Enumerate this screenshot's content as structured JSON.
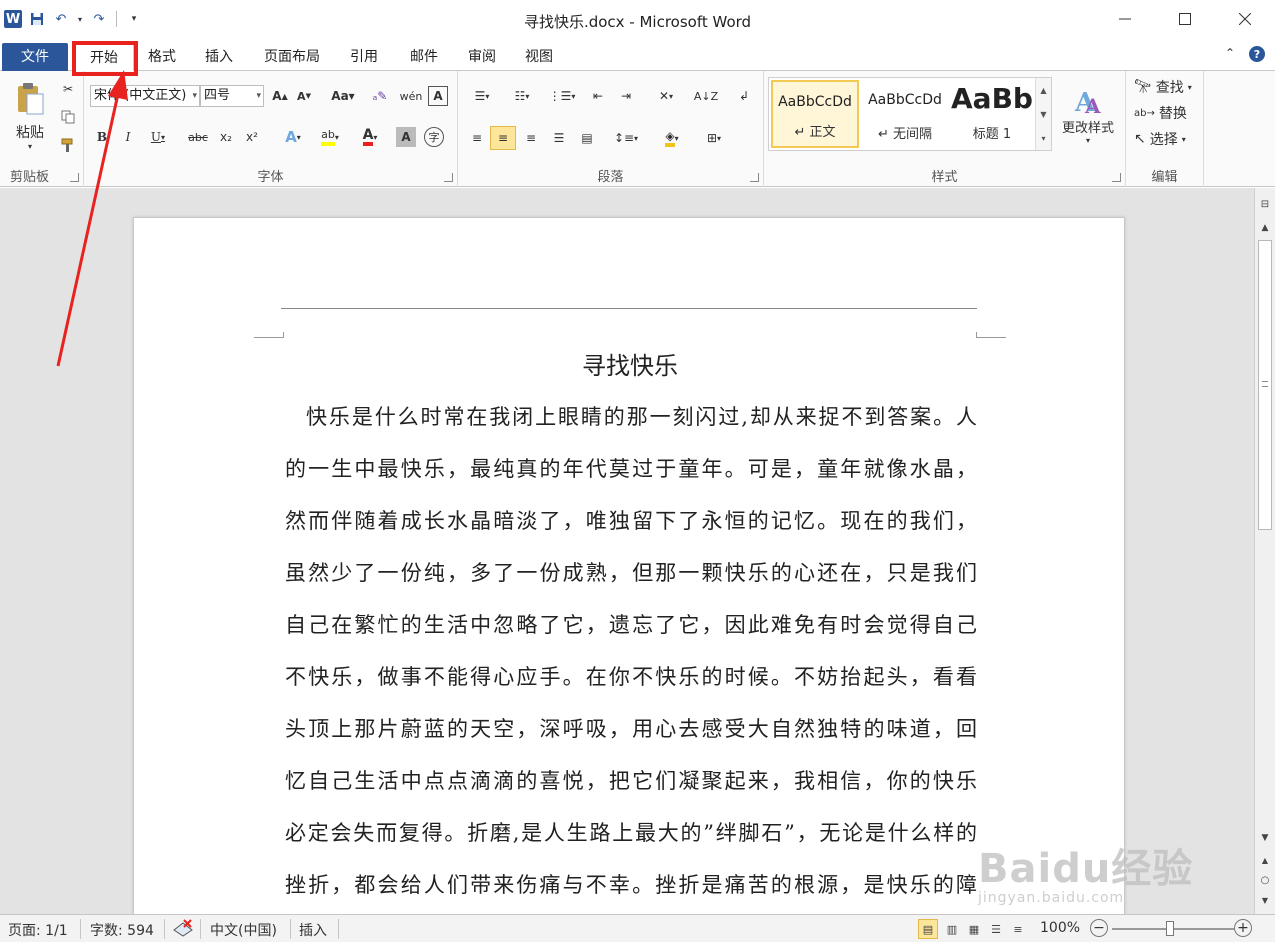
{
  "window": {
    "title": "寻找快乐.docx - Microsoft Word",
    "logo_letter": "W",
    "controls": [
      "minimize-icon",
      "maximize-icon",
      "close-icon"
    ]
  },
  "quick_access": [
    "save-icon",
    "undo-icon",
    "redo-icon",
    "customize-icon"
  ],
  "tabs": [
    {
      "label": "文件",
      "type": "file"
    },
    {
      "label": "开始",
      "active": true
    },
    {
      "label": "格式"
    },
    {
      "label": "插入"
    },
    {
      "label": "页面布局"
    },
    {
      "label": "引用"
    },
    {
      "label": "邮件"
    },
    {
      "label": "审阅"
    },
    {
      "label": "视图"
    }
  ],
  "ribbon": {
    "clipboard": {
      "paste_label": "粘贴",
      "group_label": "剪贴板"
    },
    "font": {
      "font_name": "宋体 (中文正文)",
      "font_size": "四号",
      "group_label": "字体",
      "buttons": [
        "B",
        "I",
        "U",
        "abc",
        "x₂",
        "x²",
        "A",
        "A",
        "A",
        "A",
        "Aa",
        "A"
      ]
    },
    "paragraph": {
      "group_label": "段落"
    },
    "styles": {
      "group_label": "样式",
      "items": [
        {
          "sample": "AaBbCcDd",
          "name": "↵ 正文",
          "selected": true
        },
        {
          "sample": "AaBbCcDd",
          "name": "↵ 无间隔"
        },
        {
          "sample": "AaBb",
          "name": "标题 1",
          "big": true
        }
      ],
      "change_styles_label": "更改样式"
    },
    "editing": {
      "group_label": "编辑",
      "find_label": "查找",
      "replace_label": "替换",
      "select_label": "选择"
    }
  },
  "document": {
    "title": "寻找快乐",
    "lines": [
      "快乐是什么时常在我闭上眼睛的那一刻闪过,却从来捉不到答案。人",
      "的一生中最快乐，最纯真的年代莫过于童年。可是，童年就像水晶，",
      "然而伴随着成长水晶暗淡了，唯独留下了永恒的记忆。现在的我们，",
      "虽然少了一份纯，多了一份成熟，但那一颗快乐的心还在，只是我们",
      "自己在繁忙的生活中忽略了它，遗忘了它，因此难免有时会觉得自己",
      "不快乐，做事不能得心应手。在你不快乐的时候。不妨抬起头，看看",
      "头顶上那片蔚蓝的天空，深呼吸，用心去感受大自然独特的味道，回",
      "忆自己生活中点点滴滴的喜悦，把它们凝聚起来，我相信，你的快乐",
      "必定会失而复得。折磨,是人生路上最大的”绊脚石”，无论是什么样的",
      "挫折，都会给人们带来伤痛与不幸。挫折是痛苦的根源，是快乐的障"
    ]
  },
  "statusbar": {
    "page": "页面: 1/1",
    "words": "字数: 594",
    "language": "中文(中国)",
    "mode": "插入",
    "zoom": "100%",
    "zoom_minus": "−",
    "zoom_plus": "+"
  },
  "watermark": {
    "main": "Baidu经验",
    "sub": "jingyan.baidu.com"
  },
  "colors": {
    "accent": "#2b579a",
    "highlight_annotation": "#e8231f",
    "selected_style": "#f2c955"
  }
}
